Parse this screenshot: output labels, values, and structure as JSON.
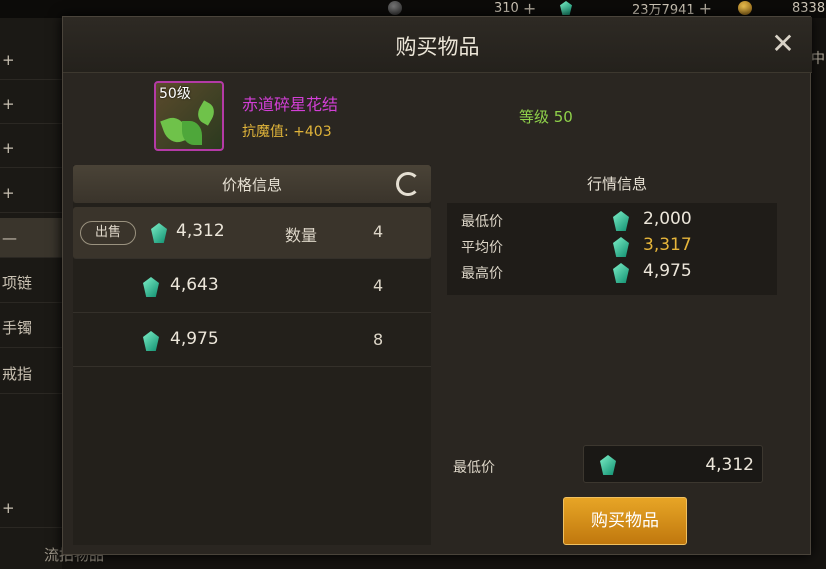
{
  "topbar": {
    "currency1": {
      "value": "310",
      "icon": "dark-coin-icon"
    },
    "currency2": {
      "value": "23万7941",
      "icon": "gem-icon"
    },
    "currency3": {
      "value": "8338",
      "icon": "gold-coin-icon"
    }
  },
  "sidebar": {
    "items": [
      {
        "label": "+"
      },
      {
        "label": "+"
      },
      {
        "label": "+"
      },
      {
        "label": "+"
      },
      {
        "label": "—"
      },
      {
        "label": "项链"
      },
      {
        "label": "手镯"
      },
      {
        "label": "戒指"
      },
      {
        "label": "+"
      }
    ],
    "bottom_label": "流拍物品",
    "right_label": "中"
  },
  "dialog": {
    "title": "购买物品",
    "close_icon": "close-icon"
  },
  "item": {
    "level_badge": "50级",
    "name": "赤道碎星花结",
    "attribute": "抗魔值: +403",
    "level_text": "等级 50",
    "name_color": "#d23fd6"
  },
  "price_panel": {
    "header": "价格信息",
    "rows": [
      {
        "tag": "出售",
        "price": "4,312",
        "qty_label": "数量",
        "qty": "4"
      },
      {
        "tag": "",
        "price": "4,643",
        "qty_label": "",
        "qty": "4"
      },
      {
        "tag": "",
        "price": "4,975",
        "qty_label": "",
        "qty": "8"
      }
    ]
  },
  "market_panel": {
    "header": "行情信息",
    "stats": [
      {
        "label": "最低价",
        "value": "2,000"
      },
      {
        "label": "平均价",
        "value": "3,317"
      },
      {
        "label": "最高价",
        "value": "4,975"
      }
    ],
    "lowest_label": "最低价",
    "lowest_value": "4,312",
    "buy_button": "购买物品",
    "avg_color": "#e6b53a"
  }
}
